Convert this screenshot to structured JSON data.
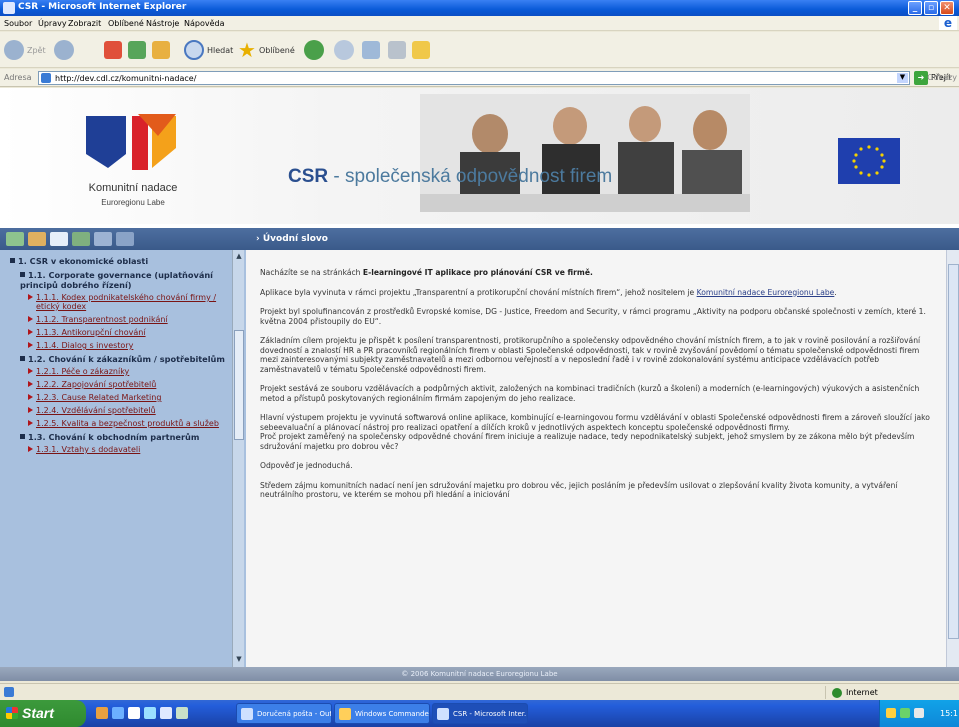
{
  "window": {
    "title": "CSR - Microsoft Internet Explorer"
  },
  "menu": [
    "Soubor",
    "Úpravy",
    "Zobrazit",
    "Oblíbené",
    "Nástroje",
    "Nápověda"
  ],
  "toolbar": {
    "back": "Zpět",
    "search": "Hledat",
    "favorites": "Oblíbené"
  },
  "address": {
    "label": "Adresa",
    "url": "http://dev.cdl.cz/komunitni-nadace/",
    "go": "Přejít",
    "links": "Odkazy"
  },
  "banner": {
    "org_name": "Komunitní nadace",
    "org_sub": "Euroregionu Labe",
    "headline_a": "CSR",
    "headline_b": " - společenská odpovědnost firem"
  },
  "nav": {
    "section1": "1. CSR v ekonomické oblasti",
    "sub11": "1.1. Corporate governance (uplatňování principů dobrého řízení)",
    "items11": [
      "1.1.1. Kodex podnikatelského chování firmy / etický kodex",
      "1.1.2. Transparentnost podnikání",
      "1.1.3. Antikorupční chování",
      "1.1.4. Dialog s investory"
    ],
    "sub12": "1.2. Chování k zákazníkům / spotřebitelům",
    "items12": [
      "1.2.1. Péče o zákazníky",
      "1.2.2. Zapojování spotřebitelů",
      "1.2.3. Cause Related Marketing",
      "1.2.4. Vzdělávání spotřebitelů",
      "1.2.5. Kvalita a bezpečnost produktů a služeb"
    ],
    "sub13": "1.3. Chování k obchodním partnerům",
    "items13": [
      "1.3.1. Vztahy s dodavateli"
    ]
  },
  "main": {
    "header": "Úvodní slovo",
    "p1_pre": "Nacházíte se na stránkách ",
    "p1_bold": "E-learningové IT aplikace pro plánování CSR ve firmě.",
    "p2_pre": "Aplikace byla vyvinuta v rámci projektu „Transparentní a protikorupční chování místních firem“, jehož nositelem je ",
    "p2_link": "Komunitní nadace Euroregionu Labe",
    "p2_post": ".",
    "p3": "Projekt byl spolufinancován z prostředků Evropské komise, DG - Justice, Freedom and Security, v rámci programu „Aktivity na podporu občanské společnosti v zemích, které 1. května 2004 přistoupily do EU“.",
    "p4": "Základním cílem projektu je přispět k posílení transparentnosti, protikorupčního a společensky odpovědného chování místních firem, a to jak v rovině posilování a rozšiřování dovedností a znalostí HR a PR pracovníků regionálních firem v oblasti Společenské odpovědnosti, tak v rovině zvyšování povědomí o tématu společenské odpovědnosti firem mezi zainteresovanými subjekty zaměstnavatelů a mezi odbornou veřejností a v neposlední řadě i v rovině zdokonalování systému anticipace vzdělávacích potřeb zaměstnavatelů v tématu Společenské odpovědnosti firem.",
    "p5": "Projekt sestává ze souboru vzdělávacích a podpůrných aktivit, založených na kombinaci tradičních (kurzů a školení) a moderních (e-learningových) výukových a asistenčních metod a přístupů poskytovaných regionálním firmám zapojeným do jeho realizace.",
    "p6": "Hlavní výstupem projektu je vyvinutá softwarová online aplikace, kombinující e-learningovou formu vzdělávání v oblasti Společenské odpovědnosti firem a zároveň sloužící jako sebeevaluační a plánovací nástroj pro realizaci opatření a dílčích kroků v jednotlivých aspektech konceptu společenské odpovědnosti firmy.",
    "p6b": "Proč projekt zaměřený na společensky odpovědné chování firem iniciuje a realizuje nadace, tedy nepodnikatelský subjekt, jehož smyslem by ze zákona mělo být především sdružování majetku pro dobrou věc?",
    "p7": "Odpověď je jednoduchá.",
    "p8": "Středem zájmu komunitních nadací není jen sdružování majetku pro dobrou věc, jejich posláním je především usilovat o zlepšování kvality života komunity, a vytváření neutrálního prostoru, ve kterém se mohou při hledání a iniciování"
  },
  "footer": "© 2006 Komunitní nadace Euroregionu Labe",
  "status": {
    "zone": "Internet"
  },
  "taskbar": {
    "start": "Start",
    "tasks": [
      "Doručená pošta - Out...",
      "Windows Commander...",
      "CSR - Microsoft Inter..."
    ],
    "clock": "15:1"
  },
  "colors": {
    "nav_bg": "#a8c0de",
    "header_bg": "#3a5a8a",
    "link": "#7a1414"
  }
}
